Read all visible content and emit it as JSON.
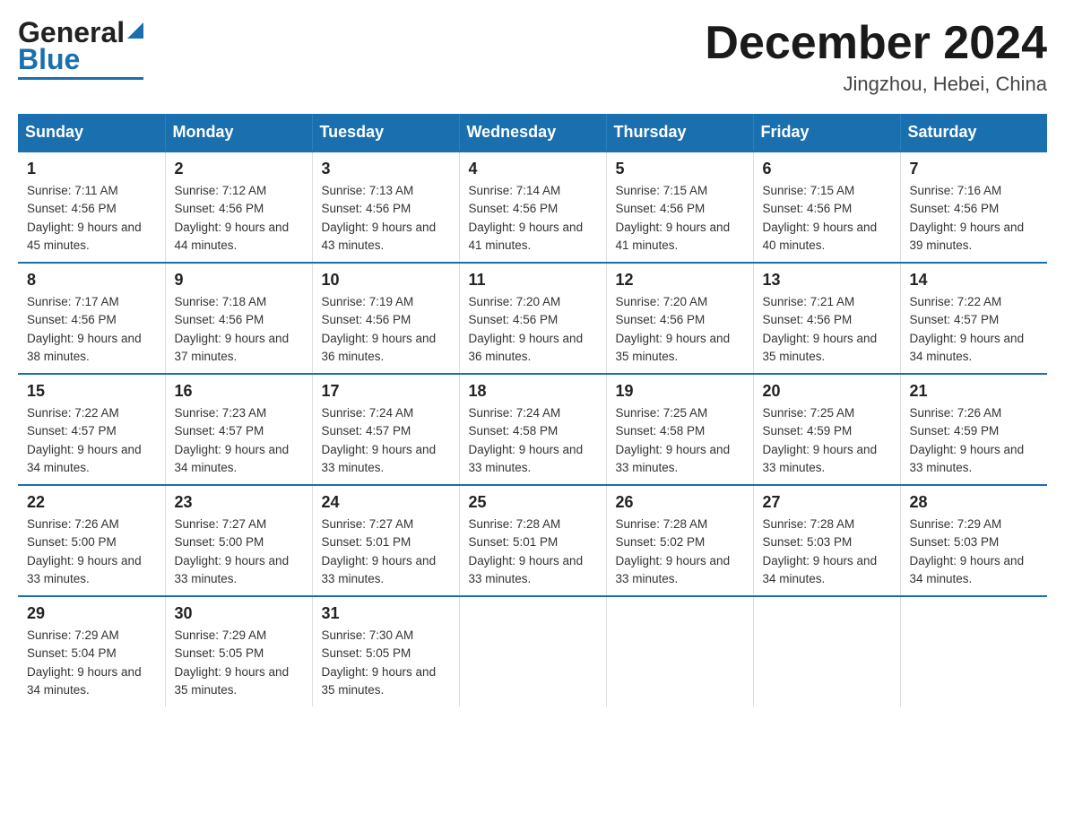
{
  "logo": {
    "line1": "General",
    "line2": "Blue"
  },
  "title": "December 2024",
  "subtitle": "Jingzhou, Hebei, China",
  "days_of_week": [
    "Sunday",
    "Monday",
    "Tuesday",
    "Wednesday",
    "Thursday",
    "Friday",
    "Saturday"
  ],
  "weeks": [
    [
      {
        "day": "1",
        "sunrise": "Sunrise: 7:11 AM",
        "sunset": "Sunset: 4:56 PM",
        "daylight": "Daylight: 9 hours and 45 minutes."
      },
      {
        "day": "2",
        "sunrise": "Sunrise: 7:12 AM",
        "sunset": "Sunset: 4:56 PM",
        "daylight": "Daylight: 9 hours and 44 minutes."
      },
      {
        "day": "3",
        "sunrise": "Sunrise: 7:13 AM",
        "sunset": "Sunset: 4:56 PM",
        "daylight": "Daylight: 9 hours and 43 minutes."
      },
      {
        "day": "4",
        "sunrise": "Sunrise: 7:14 AM",
        "sunset": "Sunset: 4:56 PM",
        "daylight": "Daylight: 9 hours and 41 minutes."
      },
      {
        "day": "5",
        "sunrise": "Sunrise: 7:15 AM",
        "sunset": "Sunset: 4:56 PM",
        "daylight": "Daylight: 9 hours and 41 minutes."
      },
      {
        "day": "6",
        "sunrise": "Sunrise: 7:15 AM",
        "sunset": "Sunset: 4:56 PM",
        "daylight": "Daylight: 9 hours and 40 minutes."
      },
      {
        "day": "7",
        "sunrise": "Sunrise: 7:16 AM",
        "sunset": "Sunset: 4:56 PM",
        "daylight": "Daylight: 9 hours and 39 minutes."
      }
    ],
    [
      {
        "day": "8",
        "sunrise": "Sunrise: 7:17 AM",
        "sunset": "Sunset: 4:56 PM",
        "daylight": "Daylight: 9 hours and 38 minutes."
      },
      {
        "day": "9",
        "sunrise": "Sunrise: 7:18 AM",
        "sunset": "Sunset: 4:56 PM",
        "daylight": "Daylight: 9 hours and 37 minutes."
      },
      {
        "day": "10",
        "sunrise": "Sunrise: 7:19 AM",
        "sunset": "Sunset: 4:56 PM",
        "daylight": "Daylight: 9 hours and 36 minutes."
      },
      {
        "day": "11",
        "sunrise": "Sunrise: 7:20 AM",
        "sunset": "Sunset: 4:56 PM",
        "daylight": "Daylight: 9 hours and 36 minutes."
      },
      {
        "day": "12",
        "sunrise": "Sunrise: 7:20 AM",
        "sunset": "Sunset: 4:56 PM",
        "daylight": "Daylight: 9 hours and 35 minutes."
      },
      {
        "day": "13",
        "sunrise": "Sunrise: 7:21 AM",
        "sunset": "Sunset: 4:56 PM",
        "daylight": "Daylight: 9 hours and 35 minutes."
      },
      {
        "day": "14",
        "sunrise": "Sunrise: 7:22 AM",
        "sunset": "Sunset: 4:57 PM",
        "daylight": "Daylight: 9 hours and 34 minutes."
      }
    ],
    [
      {
        "day": "15",
        "sunrise": "Sunrise: 7:22 AM",
        "sunset": "Sunset: 4:57 PM",
        "daylight": "Daylight: 9 hours and 34 minutes."
      },
      {
        "day": "16",
        "sunrise": "Sunrise: 7:23 AM",
        "sunset": "Sunset: 4:57 PM",
        "daylight": "Daylight: 9 hours and 34 minutes."
      },
      {
        "day": "17",
        "sunrise": "Sunrise: 7:24 AM",
        "sunset": "Sunset: 4:57 PM",
        "daylight": "Daylight: 9 hours and 33 minutes."
      },
      {
        "day": "18",
        "sunrise": "Sunrise: 7:24 AM",
        "sunset": "Sunset: 4:58 PM",
        "daylight": "Daylight: 9 hours and 33 minutes."
      },
      {
        "day": "19",
        "sunrise": "Sunrise: 7:25 AM",
        "sunset": "Sunset: 4:58 PM",
        "daylight": "Daylight: 9 hours and 33 minutes."
      },
      {
        "day": "20",
        "sunrise": "Sunrise: 7:25 AM",
        "sunset": "Sunset: 4:59 PM",
        "daylight": "Daylight: 9 hours and 33 minutes."
      },
      {
        "day": "21",
        "sunrise": "Sunrise: 7:26 AM",
        "sunset": "Sunset: 4:59 PM",
        "daylight": "Daylight: 9 hours and 33 minutes."
      }
    ],
    [
      {
        "day": "22",
        "sunrise": "Sunrise: 7:26 AM",
        "sunset": "Sunset: 5:00 PM",
        "daylight": "Daylight: 9 hours and 33 minutes."
      },
      {
        "day": "23",
        "sunrise": "Sunrise: 7:27 AM",
        "sunset": "Sunset: 5:00 PM",
        "daylight": "Daylight: 9 hours and 33 minutes."
      },
      {
        "day": "24",
        "sunrise": "Sunrise: 7:27 AM",
        "sunset": "Sunset: 5:01 PM",
        "daylight": "Daylight: 9 hours and 33 minutes."
      },
      {
        "day": "25",
        "sunrise": "Sunrise: 7:28 AM",
        "sunset": "Sunset: 5:01 PM",
        "daylight": "Daylight: 9 hours and 33 minutes."
      },
      {
        "day": "26",
        "sunrise": "Sunrise: 7:28 AM",
        "sunset": "Sunset: 5:02 PM",
        "daylight": "Daylight: 9 hours and 33 minutes."
      },
      {
        "day": "27",
        "sunrise": "Sunrise: 7:28 AM",
        "sunset": "Sunset: 5:03 PM",
        "daylight": "Daylight: 9 hours and 34 minutes."
      },
      {
        "day": "28",
        "sunrise": "Sunrise: 7:29 AM",
        "sunset": "Sunset: 5:03 PM",
        "daylight": "Daylight: 9 hours and 34 minutes."
      }
    ],
    [
      {
        "day": "29",
        "sunrise": "Sunrise: 7:29 AM",
        "sunset": "Sunset: 5:04 PM",
        "daylight": "Daylight: 9 hours and 34 minutes."
      },
      {
        "day": "30",
        "sunrise": "Sunrise: 7:29 AM",
        "sunset": "Sunset: 5:05 PM",
        "daylight": "Daylight: 9 hours and 35 minutes."
      },
      {
        "day": "31",
        "sunrise": "Sunrise: 7:30 AM",
        "sunset": "Sunset: 5:05 PM",
        "daylight": "Daylight: 9 hours and 35 minutes."
      },
      null,
      null,
      null,
      null
    ]
  ]
}
